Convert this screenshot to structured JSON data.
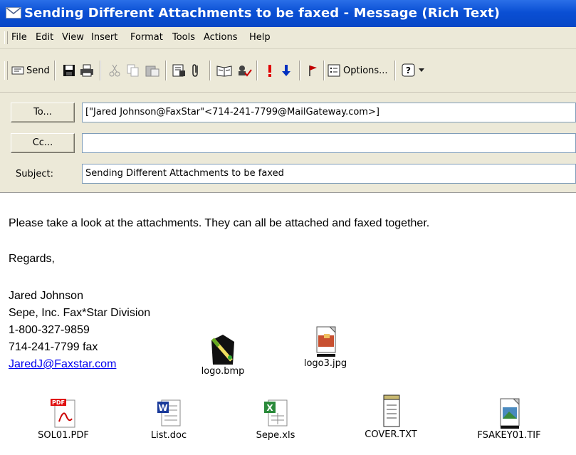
{
  "window": {
    "title": "Sending Different Attachments to be faxed - Message (Rich Text)"
  },
  "menu": [
    "File",
    "Edit",
    "View",
    "Insert",
    "Format",
    "Tools",
    "Actions",
    "Help"
  ],
  "toolbar": {
    "send_label": "Send",
    "options_label": "Options..."
  },
  "header": {
    "to_label": "To...",
    "to_value": "[\"Jared Johnson@FaxStar\"<714-241-7799@MailGateway.com>]",
    "cc_label": "Cc...",
    "cc_value": "",
    "subject_label": "Subject:",
    "subject_value": "Sending Different Attachments to be faxed"
  },
  "body": {
    "line1": "Please take a look at the attachments.  They can all be attached and faxed together.",
    "regards": "Regards,",
    "sig_name": "Jared Johnson",
    "sig_company": "Sepe, Inc. Fax*Star Division",
    "sig_phone": "1-800-327-9859",
    "sig_fax": "714-241-7799 fax",
    "sig_email": "JaredJ@Faxstar.com"
  },
  "attachments": [
    {
      "name": "logo.bmp",
      "icon": "paint-icon"
    },
    {
      "name": "logo3.jpg",
      "icon": "image-icon"
    },
    {
      "name": "SOL01.PDF",
      "icon": "pdf-icon"
    },
    {
      "name": "List.doc",
      "icon": "word-icon"
    },
    {
      "name": "Sepe.xls",
      "icon": "excel-icon"
    },
    {
      "name": "COVER.TXT",
      "icon": "text-icon"
    },
    {
      "name": "FSAKEY01.TIF",
      "icon": "tif-icon"
    }
  ]
}
